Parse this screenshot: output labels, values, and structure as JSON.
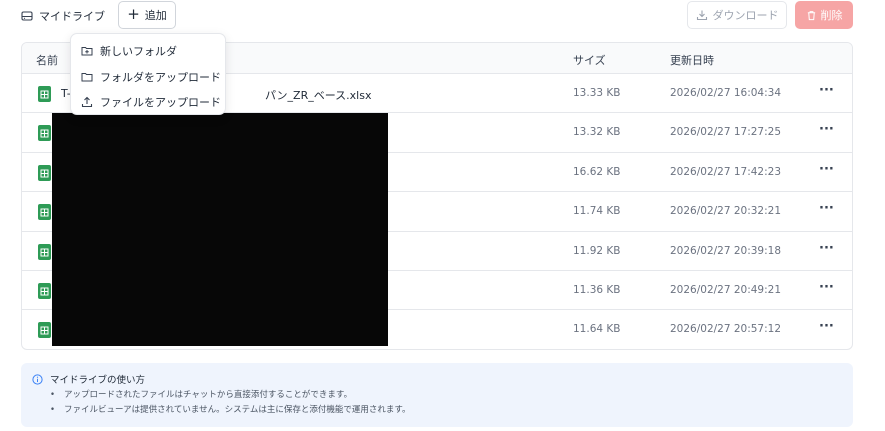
{
  "header": {
    "title": "マイドライブ",
    "add_label": "追加",
    "download_label": "ダウンロード",
    "delete_label": "削除"
  },
  "dropdown": {
    "new_folder": "新しいフォルダ",
    "upload_folder": "フォルダをアップロード",
    "upload_file": "ファイルをアップロード"
  },
  "table": {
    "col_name": "名前",
    "col_size": "サイズ",
    "col_updated": "更新日時",
    "rows": [
      {
        "name": "T-",
        "name_suffix": "パン_ZR_ベース.xlsx",
        "size": "13.33 KB",
        "updated": "2026/02/27 16:04:34"
      },
      {
        "name": "",
        "size": "13.32 KB",
        "updated": "2026/02/27 17:27:25"
      },
      {
        "name": "",
        "size": "16.62 KB",
        "updated": "2026/02/27 17:42:23"
      },
      {
        "name": "",
        "size": "11.74 KB",
        "updated": "2026/02/27 20:32:21"
      },
      {
        "name": "",
        "size": "11.92 KB",
        "updated": "2026/02/27 20:39:18"
      },
      {
        "name": "",
        "size": "11.36 KB",
        "updated": "2026/02/27 20:49:21"
      },
      {
        "name": "",
        "size": "11.64 KB",
        "updated": "2026/02/27 20:57:12"
      }
    ]
  },
  "info": {
    "title": "マイドライブの使い方",
    "items": [
      "アップロードされたファイルはチャットから直接添付することができます。",
      "ファイルビューアは提供されていません。システムは主に保存と添付機能で運用されます。"
    ]
  },
  "colors": {
    "delete_bg": "#f6a5a5",
    "excel_green": "#2e9b56",
    "info_bg": "#eff4fd",
    "info_icon": "#3b82f6"
  }
}
